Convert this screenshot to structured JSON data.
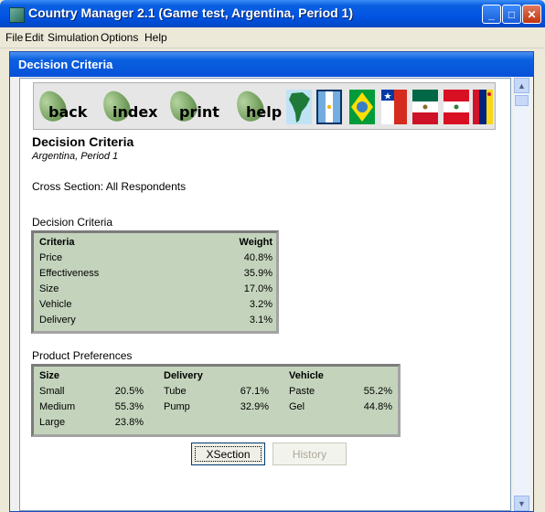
{
  "window": {
    "title": "Country Manager 2.1 (Game test, Argentina, Period 1)"
  },
  "menu": [
    "File",
    "Edit",
    "Simulation",
    "Options",
    "Help"
  ],
  "child_window": {
    "title": "Decision Criteria"
  },
  "toolbar": {
    "buttons": [
      "back",
      "index",
      "print",
      "help"
    ],
    "icons": [
      "south-america-map-icon",
      "argentina-flag-icon",
      "brazil-flag-icon",
      "chile-flag-icon",
      "mexico-flag-icon",
      "peru-flag-icon",
      "venezuela-flag-icon"
    ]
  },
  "page": {
    "title": "Decision Criteria",
    "subtitle": "Argentina, Period 1",
    "cross_section": "Cross Section: All Respondents"
  },
  "criteria": {
    "section_label": "Decision Criteria",
    "headers": [
      "Criteria",
      "Weight"
    ],
    "rows": [
      {
        "name": "Price",
        "weight": "40.8%"
      },
      {
        "name": "Effectiveness",
        "weight": "35.9%"
      },
      {
        "name": "Size",
        "weight": "17.0%"
      },
      {
        "name": "Vehicle",
        "weight": "3.2%"
      },
      {
        "name": "Delivery",
        "weight": "3.1%"
      }
    ]
  },
  "preferences": {
    "section_label": "Product Preferences",
    "headers": [
      "Size",
      "Delivery",
      "Vehicle"
    ],
    "size": [
      {
        "name": "Small",
        "value": "20.5%"
      },
      {
        "name": "Medium",
        "value": "55.3%"
      },
      {
        "name": "Large",
        "value": "23.8%"
      }
    ],
    "delivery": [
      {
        "name": "Tube",
        "value": "67.1%"
      },
      {
        "name": "Pump",
        "value": "32.9%"
      }
    ],
    "vehicle": [
      {
        "name": "Paste",
        "value": "55.2%"
      },
      {
        "name": "Gel",
        "value": "44.8%"
      }
    ]
  },
  "buttons": {
    "xsection": "XSection",
    "history": "History"
  }
}
